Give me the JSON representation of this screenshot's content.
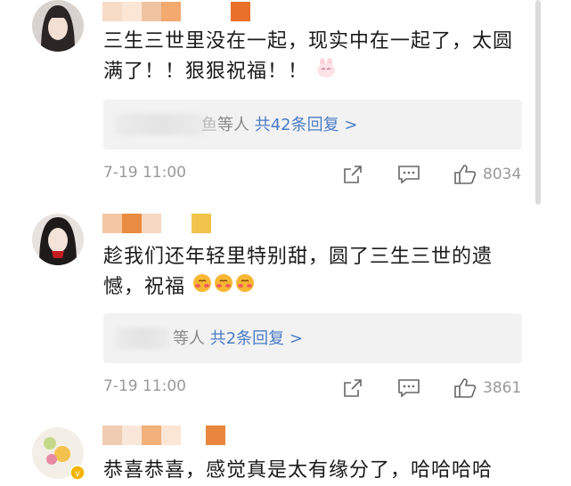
{
  "comments": [
    {
      "text": "三生三世里没在一起，现实中在一起了，太圆满了！！狠狠祝福！！",
      "emoji_suffix": "bunny-face",
      "reply_prefix": "等人",
      "reply_prefix_partial": "鱼",
      "reply_count_label": "共42条回复 >",
      "date": "7-19 11:00",
      "likes": "8034",
      "name_colors": [
        "#f7dcc8",
        "#fbe6d6",
        "#f0c3a0",
        "#f4a96e",
        "#ffffff",
        "#e8702a"
      ]
    },
    {
      "text": "趁我们还年轻里特别甜，圆了三生三世的遗憾，祝福",
      "emoji_suffix": "blushing-face x3",
      "reply_prefix": "等人",
      "reply_count_label": "共2条回复 >",
      "date": "7-19 11:00",
      "likes": "3861",
      "name_colors": [
        "#f4c7a2",
        "#e98b40",
        "#f6d8c2",
        "#ffffff",
        "#f2c34a"
      ]
    },
    {
      "text": "恭喜恭喜，感觉真是太有缘分了，哈哈哈哈",
      "name_colors": [
        "#f0cdb2",
        "#f9e7d9",
        "#f2b07a",
        "#fbe5d4",
        "#ffffff",
        "#e8863e"
      ]
    }
  ],
  "icons": {
    "share": "share-icon",
    "comment": "comment-icon",
    "like": "thumbs-up-icon"
  }
}
